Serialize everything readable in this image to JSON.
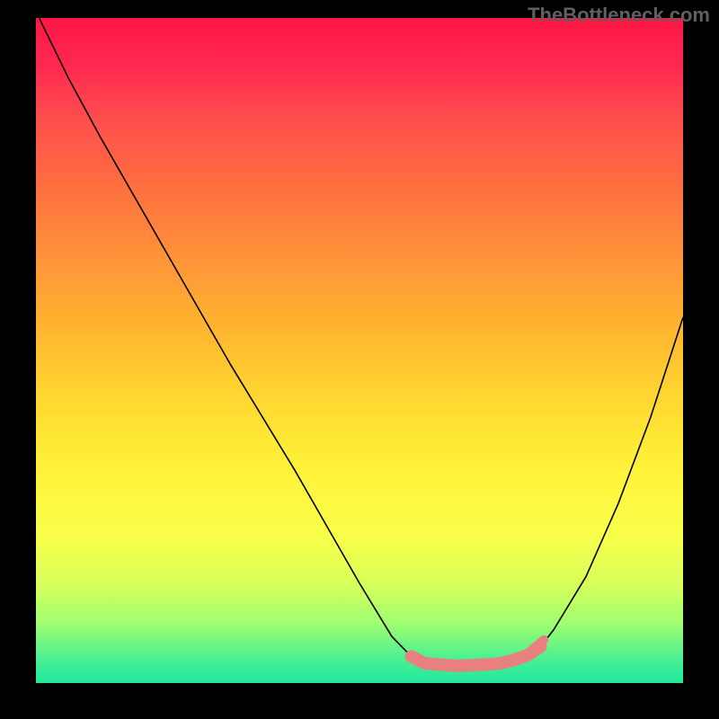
{
  "watermark": "TheBottleneck.com",
  "chart_data": {
    "type": "line",
    "title": "",
    "xlabel": "",
    "ylabel": "",
    "xlim": [
      0,
      100
    ],
    "ylim": [
      0,
      100
    ],
    "series": [
      {
        "name": "curve",
        "x": [
          0.5,
          5,
          10,
          20,
          30,
          40,
          50,
          55,
          58,
          60,
          62,
          65,
          68,
          70,
          72,
          74,
          76,
          78,
          80,
          85,
          90,
          95,
          100
        ],
        "y": [
          100,
          91,
          82,
          65,
          48,
          32,
          15,
          7,
          4,
          3,
          2.8,
          2.6,
          2.7,
          2.8,
          3,
          3.5,
          4.2,
          5.5,
          8,
          16,
          27,
          40,
          55
        ]
      }
    ],
    "highlight_band": {
      "name": "bottleneck-zone",
      "color": "#e88080",
      "x_start": 56,
      "x_end": 78,
      "y_level": 3
    },
    "gradient_background": {
      "top_color": "#ff1744",
      "bottom_color": "#1fe89f",
      "meaning": "red=high, green=low"
    }
  }
}
